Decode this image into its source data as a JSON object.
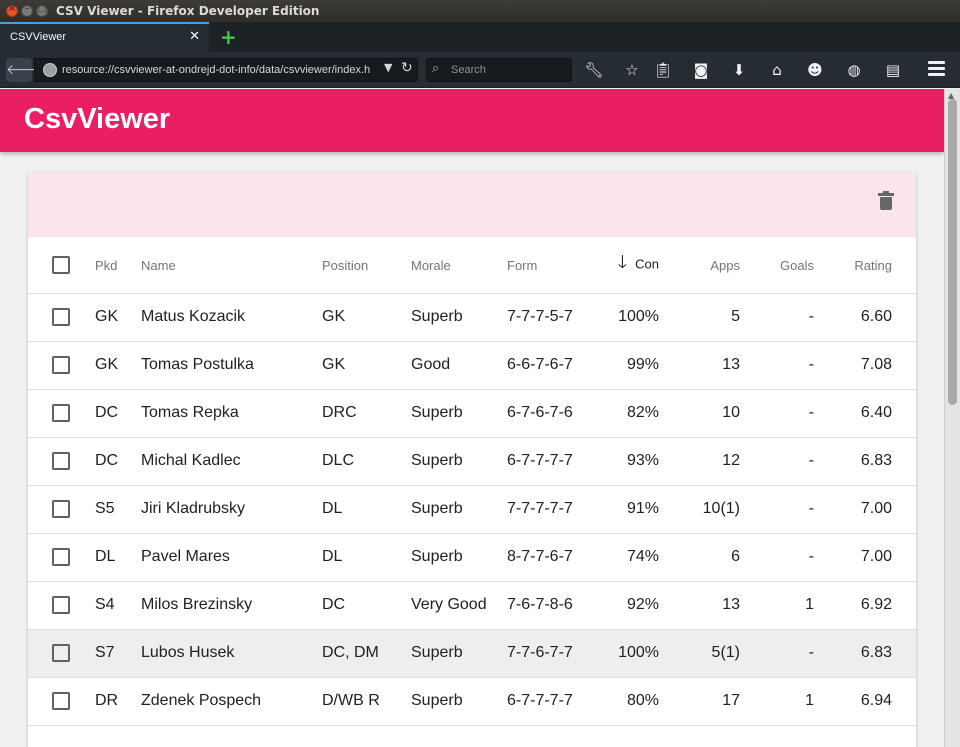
{
  "window": {
    "title": "CSV Viewer - Firefox Developer Edition"
  },
  "browser": {
    "tab_label": "CSVViewer",
    "url": "resource://csvviewer-at-ondrejd-dot-info/data/csvviewer/index.h",
    "search_placeholder": "Search"
  },
  "app": {
    "title": "CsvViewer"
  },
  "table": {
    "headers": {
      "pkd": "Pkd",
      "name": "Name",
      "position": "Position",
      "morale": "Morale",
      "form": "Form",
      "con": "Con",
      "apps": "Apps",
      "goals": "Goals",
      "rating": "Rating"
    },
    "sorted_column": "con",
    "rows": [
      {
        "pkd": "GK",
        "name": "Matus Kozacik",
        "position": "GK",
        "morale": "Superb",
        "form": "7-7-7-5-7",
        "con": "100%",
        "apps": "5",
        "goals": "-",
        "rating": "6.60"
      },
      {
        "pkd": "GK",
        "name": "Tomas Postulka",
        "position": "GK",
        "morale": "Good",
        "form": "6-6-7-6-7",
        "con": "99%",
        "apps": "13",
        "goals": "-",
        "rating": "7.08"
      },
      {
        "pkd": "DC",
        "name": "Tomas Repka",
        "position": "DRC",
        "morale": "Superb",
        "form": "6-7-6-7-6",
        "con": "82%",
        "apps": "10",
        "goals": "-",
        "rating": "6.40"
      },
      {
        "pkd": "DC",
        "name": "Michal Kadlec",
        "position": "DLC",
        "morale": "Superb",
        "form": "6-7-7-7-7",
        "con": "93%",
        "apps": "12",
        "goals": "-",
        "rating": "6.83"
      },
      {
        "pkd": "S5",
        "name": "Jiri Kladrubsky",
        "position": "DL",
        "morale": "Superb",
        "form": "7-7-7-7-7",
        "con": "91%",
        "apps": "10(1)",
        "goals": "-",
        "rating": "7.00"
      },
      {
        "pkd": "DL",
        "name": "Pavel Mares",
        "position": "DL",
        "morale": "Superb",
        "form": "8-7-7-6-7",
        "con": "74%",
        "apps": "6",
        "goals": "-",
        "rating": "7.00"
      },
      {
        "pkd": "S4",
        "name": "Milos Brezinsky",
        "position": "DC",
        "morale": "Very Good",
        "form": "7-6-7-8-6",
        "con": "92%",
        "apps": "13",
        "goals": "1",
        "rating": "6.92"
      },
      {
        "pkd": "S7",
        "name": "Lubos Husek",
        "position": "DC, DM",
        "morale": "Superb",
        "form": "7-7-6-7-7",
        "con": "100%",
        "apps": "5(1)",
        "goals": "-",
        "rating": "6.83",
        "highlighted": true
      },
      {
        "pkd": "DR",
        "name": "Zdenek Pospech",
        "position": "D/WB R",
        "morale": "Superb",
        "form": "6-7-7-7-7",
        "con": "80%",
        "apps": "17",
        "goals": "1",
        "rating": "6.94"
      }
    ]
  },
  "colors": {
    "accent": "#e91e63",
    "header_tint": "#fce4ec"
  }
}
